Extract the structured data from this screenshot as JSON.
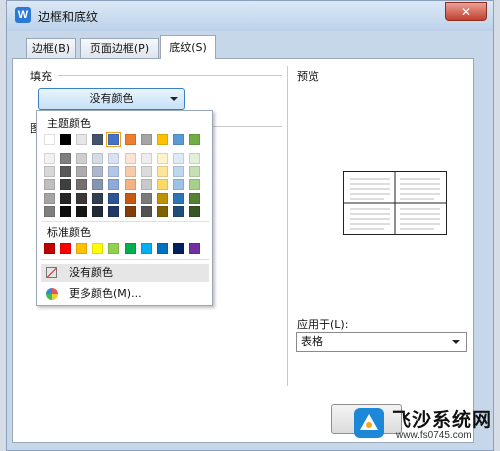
{
  "window": {
    "title": "边框和底纹",
    "app_icon_letter": "W",
    "close_symbol": "✕"
  },
  "tabs": [
    {
      "label": "边框(B)",
      "active": false
    },
    {
      "label": "页面边框(P)",
      "active": false
    },
    {
      "label": "底纹(S)",
      "active": true
    }
  ],
  "fill": {
    "section_label": "填充",
    "dropdown_value": "没有颜色"
  },
  "pattern": {
    "section_label_partial": "图"
  },
  "preview": {
    "label": "预览"
  },
  "apply_to": {
    "label": "应用于(L):",
    "value": "表格"
  },
  "color_popup": {
    "theme_label": "主题颜色",
    "theme_top_row": [
      "#ffffff",
      "#000000",
      "#e7e6e6",
      "#44546a",
      "#4472c4",
      "#ed7d31",
      "#a5a5a5",
      "#ffc000",
      "#5b9bd5",
      "#70ad47"
    ],
    "theme_selected_index": 4,
    "theme_shades": [
      [
        "#f2f2f2",
        "#7f7f7f",
        "#d0cece",
        "#d6dce4",
        "#d9e2f3",
        "#fbe4d5",
        "#ededed",
        "#fff2cc",
        "#deebf6",
        "#e2efd9"
      ],
      [
        "#d8d8d8",
        "#595959",
        "#aeabab",
        "#adb9ca",
        "#b4c6e7",
        "#f7caac",
        "#dbdbdb",
        "#fee599",
        "#bdd7ee",
        "#c5e0b3"
      ],
      [
        "#bfbfbf",
        "#3f3f3f",
        "#757070",
        "#8496b0",
        "#8eaadb",
        "#f4b183",
        "#c9c9c9",
        "#ffd965",
        "#9cc3e5",
        "#a8d08d"
      ],
      [
        "#a5a5a5",
        "#262626",
        "#3a3838",
        "#323f4f",
        "#2f5496",
        "#c45911",
        "#7b7b7b",
        "#bf9000",
        "#2e75b5",
        "#538135"
      ],
      [
        "#7f7f7f",
        "#0c0c0c",
        "#171616",
        "#222a35",
        "#1f3864",
        "#833c0b",
        "#525252",
        "#7f6000",
        "#1e4e79",
        "#375623"
      ]
    ],
    "standard_label": "标准颜色",
    "standard_colors": [
      "#c00000",
      "#ff0000",
      "#ffc000",
      "#ffff00",
      "#92d050",
      "#00b050",
      "#00b0f0",
      "#0070c0",
      "#002060",
      "#7030a0"
    ],
    "no_color_label": "没有颜色",
    "more_colors_label": "更多颜色(M)..."
  },
  "watermark": {
    "name": "飞沙系统网",
    "url": "www.fs0745.com"
  }
}
